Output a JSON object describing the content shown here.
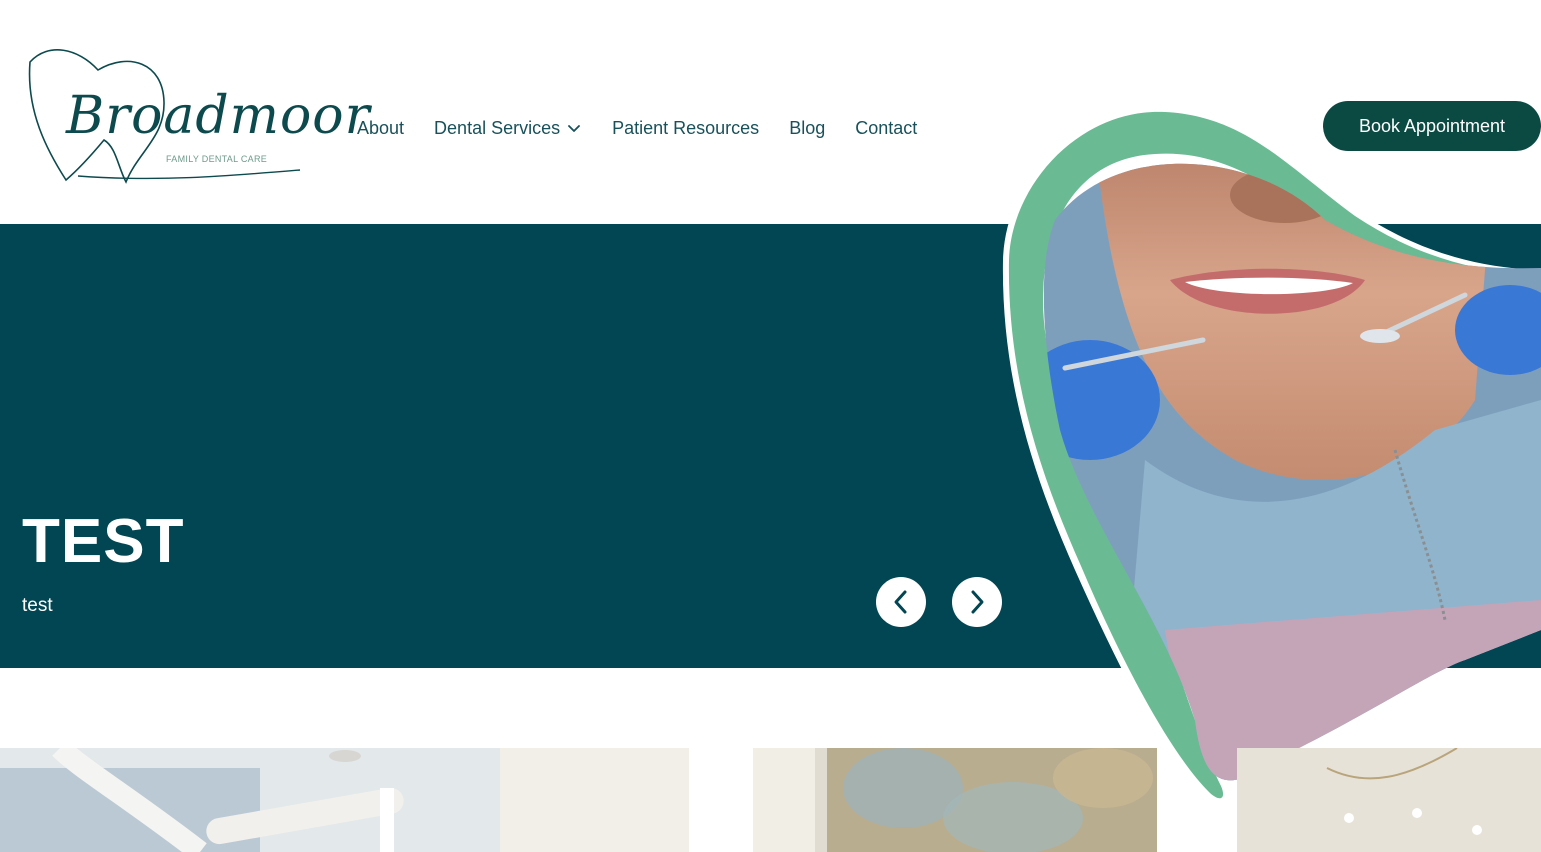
{
  "brand": {
    "name": "Broadmoor",
    "tagline": "FAMILY DENTAL CARE"
  },
  "nav": {
    "items": [
      {
        "label": "About"
      },
      {
        "label": "Dental Services"
      },
      {
        "label": "Patient Resources"
      },
      {
        "label": "Blog"
      },
      {
        "label": "Contact"
      }
    ]
  },
  "cta": {
    "label": "Book Appointment"
  },
  "hero": {
    "title": "TEST",
    "subtitle": "test"
  },
  "icons": {
    "dropdown": "chevron-down-icon",
    "prev": "chevron-left-icon",
    "next": "chevron-right-icon"
  },
  "colors": {
    "primary": "#014652",
    "button": "#0b4a42",
    "accent": "#6aba94",
    "text": "#19515a",
    "white": "#ffffff"
  }
}
